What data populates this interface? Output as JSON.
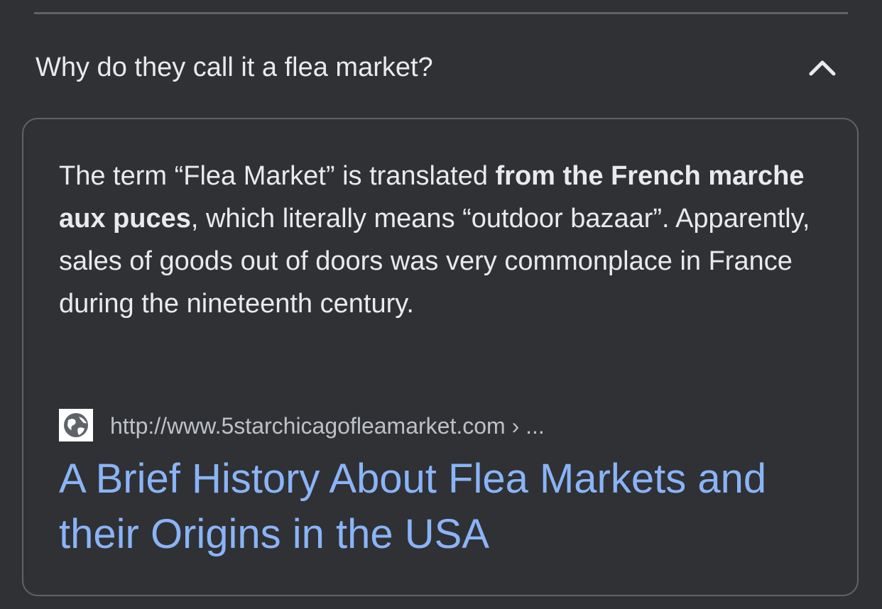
{
  "faq": {
    "question": "Why do they call it a flea market?",
    "expanded_icon": "chevron-up-icon"
  },
  "answer": {
    "text_part1": "The term “Flea Market” is translated ",
    "bold_part": "from the French marche aux puces",
    "text_part2": ", which literally means “outdoor bazaar”. Apparently, sales of goods out of doors was very commonplace in France during the nineteenth century."
  },
  "source": {
    "favicon": "globe-icon",
    "url": "http://www.5starchicagofleamarket.com › ...",
    "title": "A Brief History About Flea Markets and their Origins in the USA"
  },
  "colors": {
    "background": "#303134",
    "text": "#e8eaed",
    "secondary_text": "#bdc1c6",
    "link": "#8ab4f8",
    "divider": "#5f6368"
  }
}
